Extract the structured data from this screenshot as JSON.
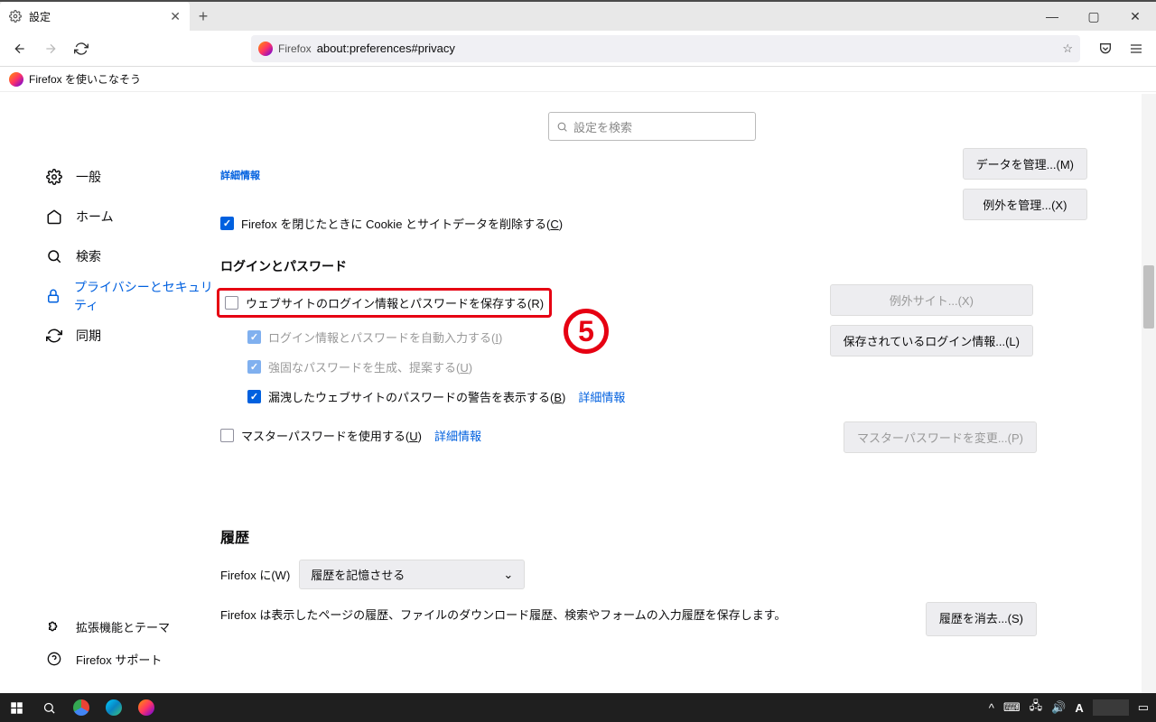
{
  "window": {
    "tab_title": "設定",
    "minimize": "—",
    "maximize": "▢",
    "close": "✕"
  },
  "url": {
    "firefox_label": "Firefox",
    "address": "about:preferences#privacy"
  },
  "bookmark": {
    "label": "Firefox を使いこなそう"
  },
  "search": {
    "placeholder": "設定を検索"
  },
  "topLink": "詳細情報",
  "sidebar": {
    "items": [
      {
        "label": "一般"
      },
      {
        "label": "ホーム"
      },
      {
        "label": "検索"
      },
      {
        "label": "プライバシーとセキュリティ"
      },
      {
        "label": "同期"
      }
    ],
    "footer": [
      {
        "label": "拡張機能とテーマ"
      },
      {
        "label": "Firefox サポート"
      }
    ]
  },
  "buttons": {
    "manageData": "データを管理...(M)",
    "manageExceptions": "例外を管理...(X)",
    "exceptionSites": "例外サイト...(X)",
    "savedLogins": "保存されているログイン情報...(L)",
    "changeMaster": "マスターパスワードを変更...(P)",
    "clearHistory": "履歴を消去...(S)"
  },
  "checks": {
    "deleteCookies_pre": "Firefox を閉じたときに Cookie とサイトデータを削除する(",
    "deleteCookies_u": "C",
    "savePasswords_pre": "ウェブサイトのログイン情報とパスワードを保存する(",
    "savePasswords_u": "R",
    "autofill_pre": "ログイン情報とパスワードを自動入力する(",
    "autofill_u": "I",
    "strongPw_pre": "強固なパスワードを生成、提案する(",
    "strongPw_u": "U",
    "breachAlert_pre": "漏洩したウェブサイトのパスワードの警告を表示する(",
    "breachAlert_u": "B",
    "masterPw_pre": "マスターパスワードを使用する(",
    "masterPw_u": "U",
    "close_paren": ")"
  },
  "links": {
    "moreInfo": "詳細情報"
  },
  "sections": {
    "logins": "ログインとパスワード",
    "history": "履歴"
  },
  "history": {
    "firefox_will_pre": "Firefox に(",
    "firefox_will_u": "W",
    "select_value": "履歴を記憶させる",
    "desc": "Firefox は表示したページの履歴、ファイルのダウンロード履歴、検索やフォームの入力履歴を保存します。"
  },
  "annotation": {
    "five": "5"
  },
  "taskbar": {
    "ime": "A"
  }
}
